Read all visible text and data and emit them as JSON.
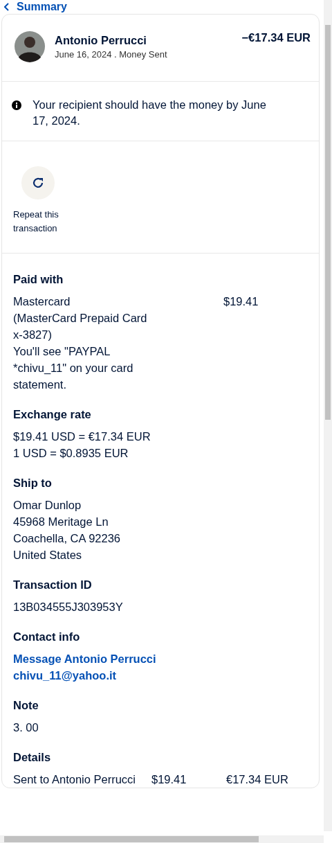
{
  "back_link": {
    "label": "Summary"
  },
  "header": {
    "name": "Antonio Perrucci",
    "subtitle": "June 16, 2024 . Money Sent",
    "amount": "−€17.34 EUR"
  },
  "notice": {
    "text": "Your recipient should have the money by June 17, 2024."
  },
  "actions": [
    {
      "label": "Repeat this transaction"
    }
  ],
  "sections": [
    {
      "kind": "paid",
      "title": "Paid with",
      "lines": [
        "Mastercard",
        "(MasterCard Prepaid Card x-3827)",
        "You'll see \"PAYPAL *chivu_11\" on your card statement."
      ],
      "amount": "$19.41"
    },
    {
      "kind": "lines",
      "title": "Exchange rate",
      "lines": [
        "$19.41 USD = €17.34 EUR",
        "1 USD = $0.8935 EUR"
      ]
    },
    {
      "kind": "lines",
      "title": "Ship to",
      "lines": [
        "Omar Dunlop",
        "45968 Meritage Ln",
        "Coachella, CA 92236",
        "United States"
      ]
    },
    {
      "kind": "lines",
      "title": "Transaction ID",
      "lines": [
        "13B034555J303953Y"
      ]
    },
    {
      "kind": "links",
      "title": "Contact info",
      "lines": [
        "Message Antonio Perrucci",
        "chivu_11@yahoo.it"
      ]
    },
    {
      "kind": "lines",
      "title": "Note",
      "lines": [
        "3. 00"
      ]
    },
    {
      "kind": "details",
      "title": "Details",
      "rows": [
        {
          "label": "Sent to Antonio Perrucci",
          "usd": "$19.41",
          "eur": "€17.34 EUR"
        }
      ]
    }
  ]
}
